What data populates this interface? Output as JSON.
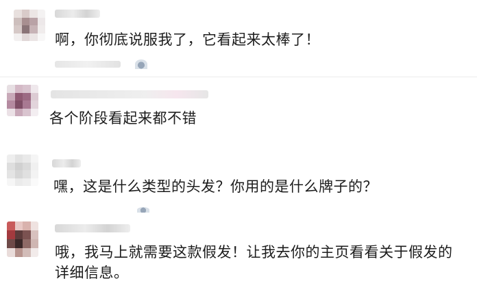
{
  "comments": [
    {
      "text": "啊，你彻底说服我了，它看起来太棒了！"
    },
    {
      "text": "各个阶段看起来都不错"
    },
    {
      "text": "嘿，这是什么类型的头发？你用的是什么牌子的？"
    },
    {
      "text_line1": "哦，我马上就需要这款假发！让我去你的主页看看关于假发的",
      "text_line2": "详细信息。"
    }
  ]
}
